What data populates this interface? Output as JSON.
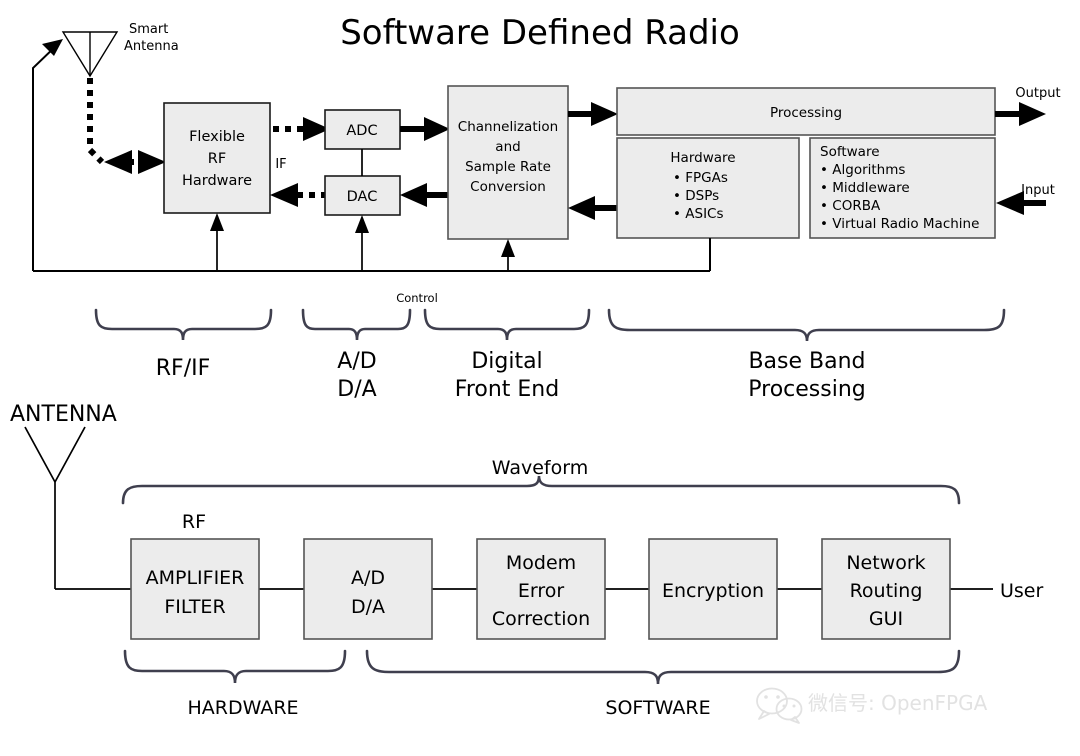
{
  "title": "Software Defined Radio",
  "top_diagram": {
    "antenna_label_line1": "Smart",
    "antenna_label_line2": "Antenna",
    "blocks": {
      "flexible_rf": [
        "Flexible",
        "RF",
        "Hardware"
      ],
      "adc": "ADC",
      "dac": "DAC",
      "channelization": [
        "Channelization",
        "and",
        "Sample Rate",
        "Conversion"
      ],
      "processing": "Processing",
      "hardware_title": "Hardware",
      "hardware_items": [
        "FPGAs",
        "DSPs",
        "ASICs"
      ],
      "software_title": "Software",
      "software_items": [
        "Algorithms",
        "Middleware",
        "CORBA",
        "Virtual Radio Machine"
      ]
    },
    "labels": {
      "if": "IF",
      "output": "Output",
      "input": "Input",
      "control": "Control"
    },
    "groups": [
      {
        "label_lines": [
          "RF/IF"
        ]
      },
      {
        "label_lines": [
          "A/D",
          "D/A"
        ]
      },
      {
        "label_lines": [
          "Digital",
          "Front End"
        ]
      },
      {
        "label_lines": [
          "Base Band",
          "Processing"
        ]
      }
    ]
  },
  "bottom_diagram": {
    "antenna_label": "ANTENNA",
    "rf_label": "RF",
    "waveform_label": "Waveform",
    "user_label": "User",
    "blocks": [
      {
        "lines": [
          "AMPLIFIER",
          "FILTER"
        ]
      },
      {
        "lines": [
          "A/D",
          "D/A"
        ]
      },
      {
        "lines": [
          "Modem",
          "Error",
          "Correction"
        ]
      },
      {
        "lines": [
          "Encryption"
        ]
      },
      {
        "lines": [
          "Network",
          "Routing",
          "GUI"
        ]
      }
    ],
    "groups": [
      {
        "label": "HARDWARE"
      },
      {
        "label": "SOFTWARE"
      }
    ]
  },
  "watermark": {
    "text": "微信号: OpenFPGA"
  },
  "colors": {
    "block_fill": "#ececec",
    "block_stroke": "#555555",
    "brace_stroke": "#3f3f4e",
    "wire": "#000000",
    "watermark": "#e2e2e2"
  }
}
